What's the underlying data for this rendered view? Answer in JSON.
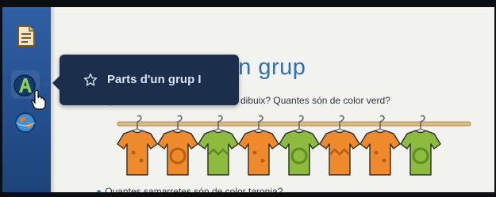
{
  "lesson": {
    "title": "art d'un grup"
  },
  "tooltip": {
    "label": "Parts d'un grup I",
    "icon": "star-outline-icon"
  },
  "questions": [
    "Quantes samarretes hi ha en el dibuix? Quantes són de color verd?",
    "Quantes samarretes són de color taronja?"
  ],
  "sidebar": {
    "items": [
      {
        "icon": "document-icon"
      },
      {
        "icon": "letter-a-activity-icon",
        "active": true
      },
      {
        "icon": "globe-icon"
      }
    ]
  },
  "illustration": {
    "shirt_colors": [
      "orange",
      "orange",
      "green",
      "orange",
      "green",
      "orange",
      "orange",
      "green"
    ]
  },
  "colors": {
    "sidebar": "#2a579a",
    "title": "#2f6fb6",
    "tooltip_bg": "#1b2f4d",
    "shirt_orange": "#ee8a2c",
    "shirt_green": "#8dbb3e"
  }
}
